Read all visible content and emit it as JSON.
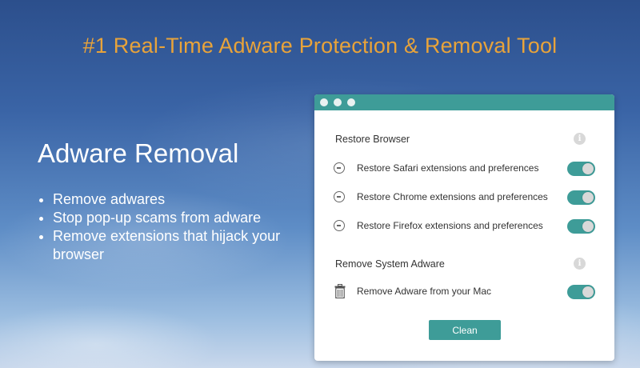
{
  "headline": "#1 Real-Time Adware Protection & Removal Tool",
  "left_panel": {
    "title": "Adware Removal",
    "bullets": [
      "Remove adwares",
      "Stop pop-up scams from adware",
      "Remove extensions that hijack your browser"
    ]
  },
  "window": {
    "sections": [
      {
        "header": "Restore Browser",
        "info_icon": "info-icon",
        "items": [
          {
            "label": "Restore Safari extensions and preferences",
            "icon": "minus-circle-icon",
            "enabled": true
          },
          {
            "label": "Restore Chrome extensions and preferences",
            "icon": "minus-circle-icon",
            "enabled": true
          },
          {
            "label": "Restore Firefox extensions and preferences",
            "icon": "minus-circle-icon",
            "enabled": true
          }
        ]
      },
      {
        "header": "Remove System Adware",
        "info_icon": "info-icon",
        "items": [
          {
            "label": "Remove Adware from your Mac",
            "icon": "trash-icon",
            "enabled": true
          }
        ]
      }
    ],
    "clean_label": "Clean"
  },
  "colors": {
    "accent": "#3e9c98",
    "headline": "#e8a33a",
    "toggle_knob": "#d9d9d9"
  }
}
